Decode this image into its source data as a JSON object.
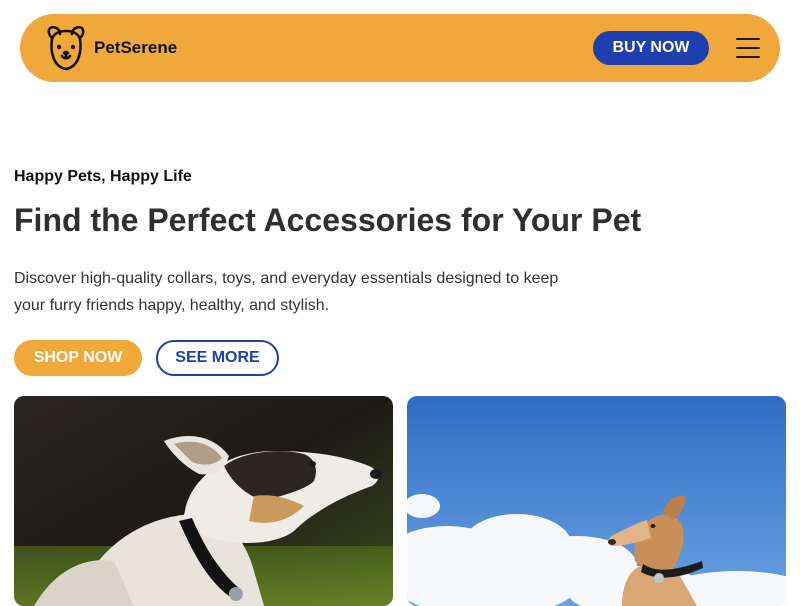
{
  "header": {
    "brand": "PetSerene",
    "logo_icon": "dog-face-icon",
    "buy_label": "BUY NOW",
    "menu_icon": "hamburger-menu-icon",
    "colors": {
      "header_bg": "#F0A83A",
      "primary": "#1E3FAE"
    }
  },
  "hero": {
    "eyebrow": "Happy Pets, Happy Life",
    "headline": "Find the Perfect Accessories for Your Pet",
    "description_line1": "Discover high-quality collars, toys, and everyday essentials designed to keep",
    "description_line2": "your furry friends happy, healthy, and stylish.",
    "shop_label": "SHOP NOW",
    "see_label": "SEE MORE"
  },
  "gallery": {
    "images": [
      {
        "name": "dog-with-collar-photo"
      },
      {
        "name": "dog-on-sky-background-photo"
      }
    ]
  }
}
